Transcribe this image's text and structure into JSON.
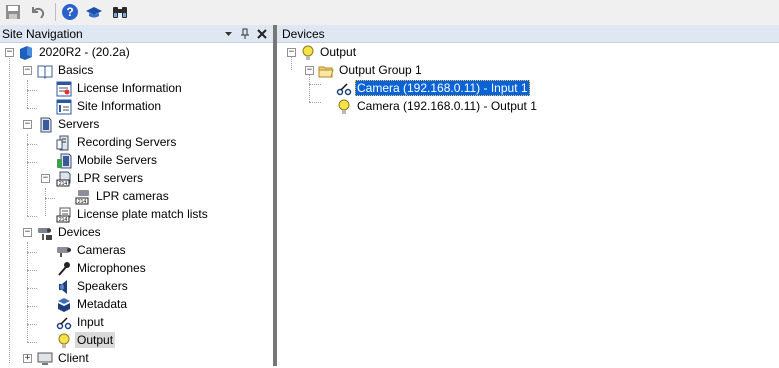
{
  "toolbar": {
    "buttons": [
      {
        "name": "save-icon"
      },
      {
        "name": "undo-icon"
      },
      {
        "name": "help-icon"
      },
      {
        "name": "tutorial-icon"
      },
      {
        "name": "binoculars-icon"
      }
    ]
  },
  "site_nav": {
    "title": "Site Navigation",
    "root": "2020R2 - (20.2a)",
    "basics": "Basics",
    "license_info": "License Information",
    "site_info": "Site Information",
    "servers": "Servers",
    "recording_servers": "Recording Servers",
    "mobile_servers": "Mobile Servers",
    "lpr_servers": "LPR servers",
    "lpr_cameras": "LPR cameras",
    "license_plate_lists": "License plate match lists",
    "devices": "Devices",
    "cameras": "Cameras",
    "microphones": "Microphones",
    "speakers": "Speakers",
    "metadata": "Metadata",
    "input": "Input",
    "output": "Output",
    "client": "Client"
  },
  "devices_pane": {
    "title": "Devices",
    "output": "Output",
    "group": "Output Group 1",
    "item_input": "Camera (192.168.0.11) - Input 1",
    "item_output": "Camera (192.168.0.11) - Output 1"
  },
  "colors": {
    "selection_blue": "#0a63d6",
    "header_bg": "#dfe7f2",
    "bulb_yellow": "#f7e24a"
  }
}
